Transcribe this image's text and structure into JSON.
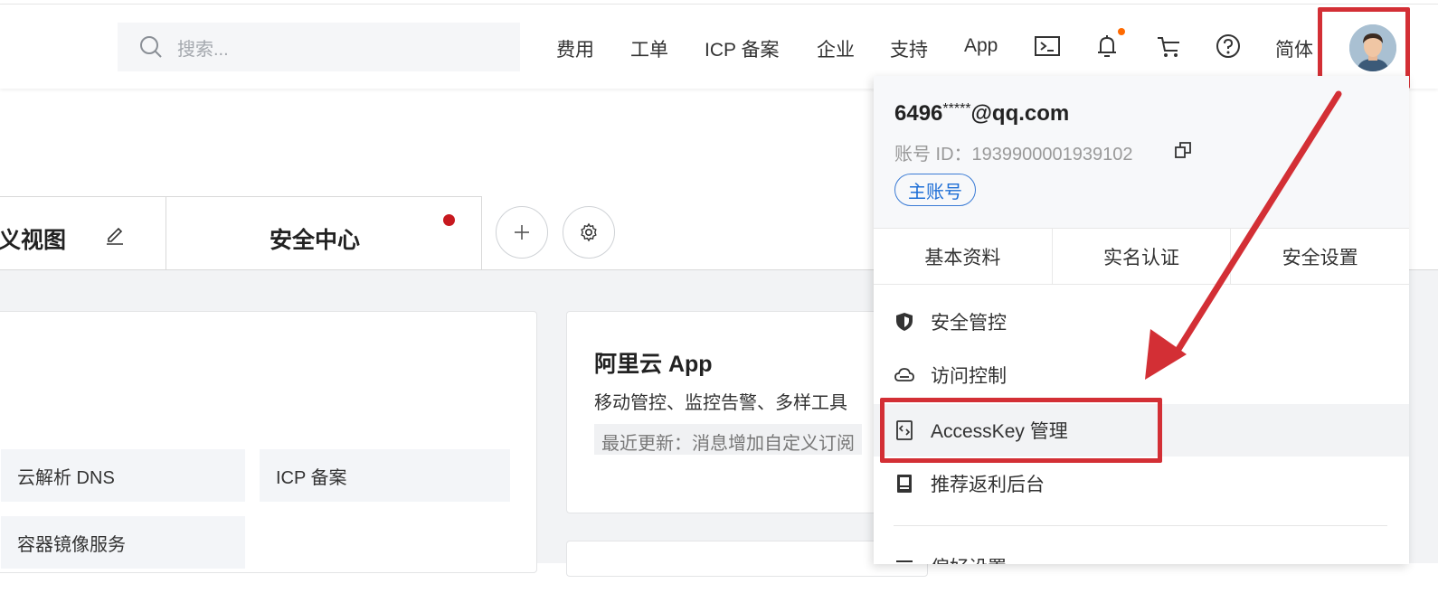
{
  "search": {
    "placeholder": "搜索..."
  },
  "topnav": {
    "items": [
      "费用",
      "工单",
      "ICP 备案",
      "企业",
      "支持",
      "App"
    ],
    "icons": [
      "terminal-icon",
      "bell-icon",
      "cart-icon",
      "help-icon"
    ],
    "language": "简体"
  },
  "tabs": {
    "left_partial": "义视图",
    "active": "安全中心"
  },
  "services": [
    "云解析 DNS",
    "ICP 备案",
    "容器镜像服务"
  ],
  "app_card": {
    "title": "阿里云 App",
    "desc": "移动管控、监控告警、多样工具",
    "update": "最近更新：消息增加自定义订阅"
  },
  "account_menu": {
    "email_prefix": "6496",
    "email_mask": "*****",
    "email_suffix": "@qq.com",
    "account_id": "账号 ID：1939900001939102",
    "badge": "主账号",
    "tabs": [
      "基本资料",
      "实名认证",
      "安全设置"
    ],
    "items": [
      "安全管控",
      "访问控制",
      "AccessKey 管理",
      "推荐返利后台",
      "偏好设置"
    ]
  },
  "colors": {
    "accent_red": "#d32f35",
    "badge_blue": "#1f6fd6",
    "notification_dot": "#ff6a00"
  }
}
